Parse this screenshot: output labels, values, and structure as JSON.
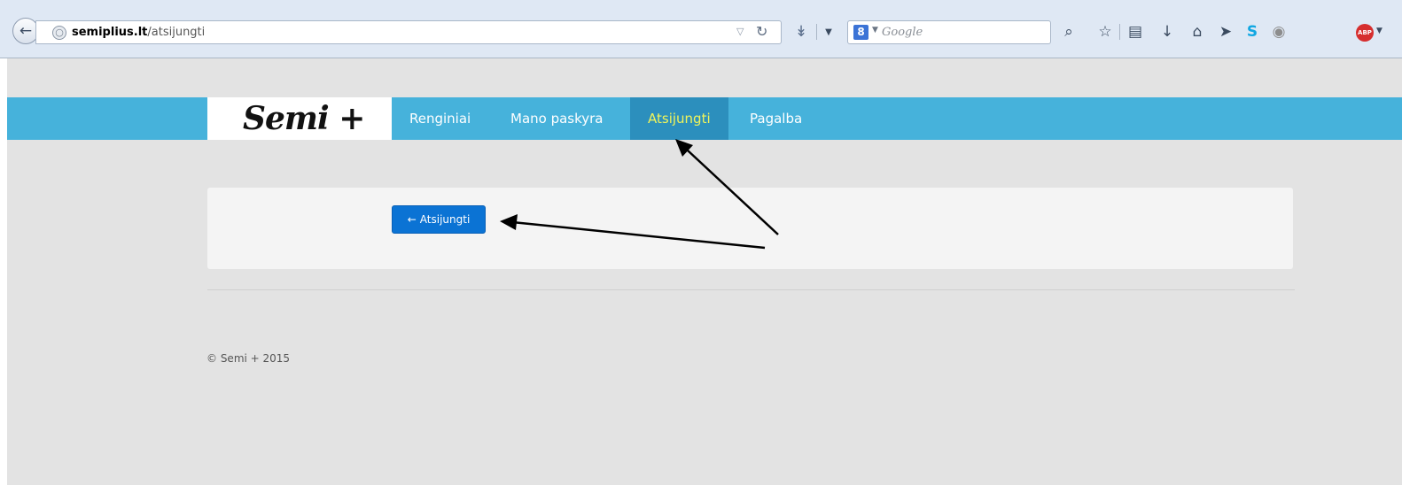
{
  "browser": {
    "url_host": "semiplius.lt",
    "url_path": "/atsijungti",
    "search_placeholder": "Google",
    "search_engine_icon": "8",
    "abp_label": "ABP"
  },
  "site": {
    "logo": "Semi +",
    "nav": [
      "Renginiai",
      "Mano paskyra",
      "Atsijungti",
      "Pagalba"
    ],
    "active_nav": "Atsijungti",
    "logout_button": "Atsijungti",
    "footer": "© Semi + 2015"
  },
  "colors": {
    "nav_bar": "#46b2db",
    "nav_active": "#2c8fbd",
    "nav_active_text": "#f0f45a",
    "button_primary": "#0b73d4",
    "page_bg": "#e3e3e3"
  },
  "icons": {
    "back": "back-arrow-icon",
    "site": "globe-icon",
    "reload": "reload-icon",
    "button": "arrow-left-icon"
  }
}
